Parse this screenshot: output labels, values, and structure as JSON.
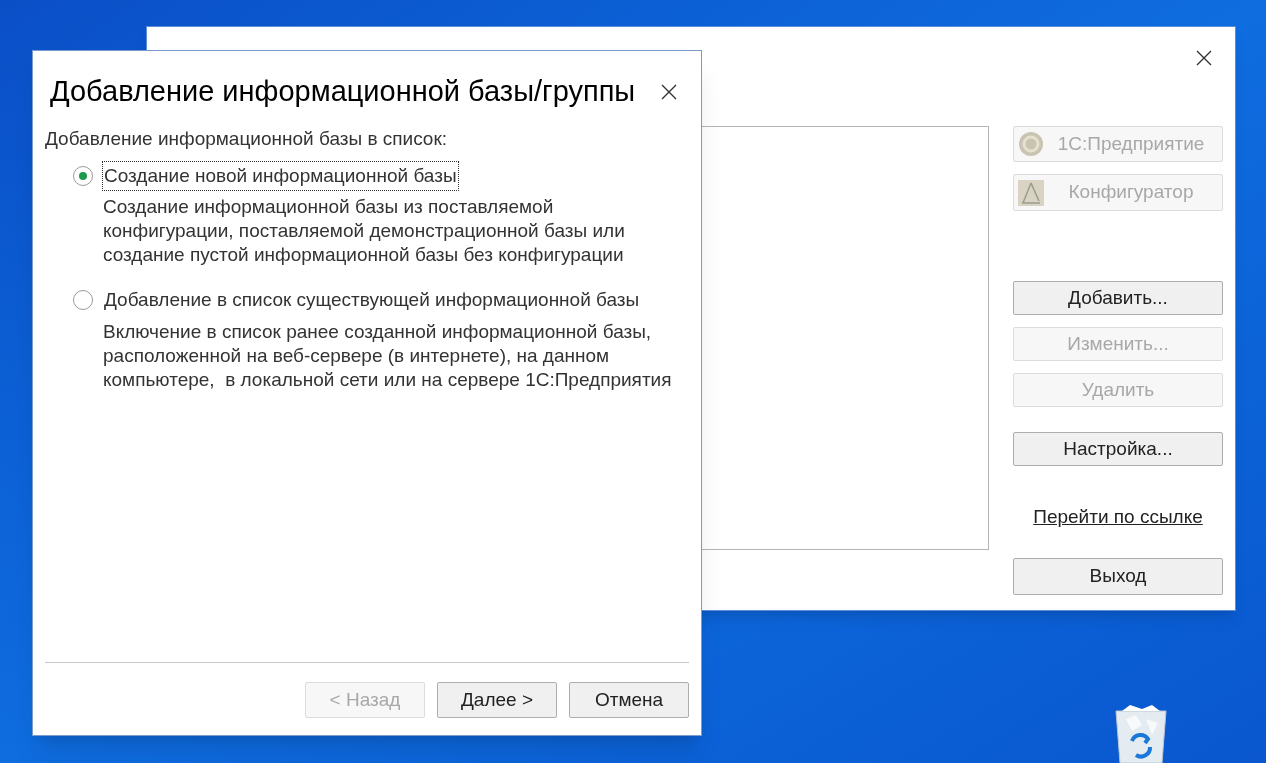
{
  "background_window": {
    "launch_buttons": [
      {
        "label": "1С:Предприятие",
        "kind": "app",
        "disabled": true
      },
      {
        "label": "Конфигуратор",
        "kind": "designer",
        "disabled": true
      }
    ],
    "edit_buttons": [
      {
        "label": "Добавить...",
        "disabled": false
      },
      {
        "label": "Изменить...",
        "disabled": true
      },
      {
        "label": "Удалить",
        "disabled": true
      }
    ],
    "settings_button": {
      "label": "Настройка...",
      "disabled": false
    },
    "link": "Перейти по ссылке",
    "exit_button": {
      "label": "Выход",
      "disabled": false
    }
  },
  "dialog": {
    "title": "Добавление информационной базы/группы",
    "heading": "Добавление информационной базы в список:",
    "options": [
      {
        "label": "Создание новой информационной базы",
        "description": "Создание информационной базы из поставляемой\nконфигурации, поставляемой демонстрационной базы или\nсоздание пустой информационной базы без конфигурации",
        "selected": true,
        "focused": true
      },
      {
        "label": "Добавление в список существующей информационной базы",
        "description": "Включение в список ранее созданной информационной базы,\nрасположенной на веб-сервере (в интернете), на данном\nкомпьютере,  в локальной сети или на сервере 1С:Предприятия",
        "selected": false,
        "focused": false
      }
    ],
    "buttons": [
      {
        "label": "< Назад",
        "disabled": true
      },
      {
        "label": "Далее >",
        "disabled": false
      },
      {
        "label": "Отмена",
        "disabled": false
      }
    ]
  }
}
